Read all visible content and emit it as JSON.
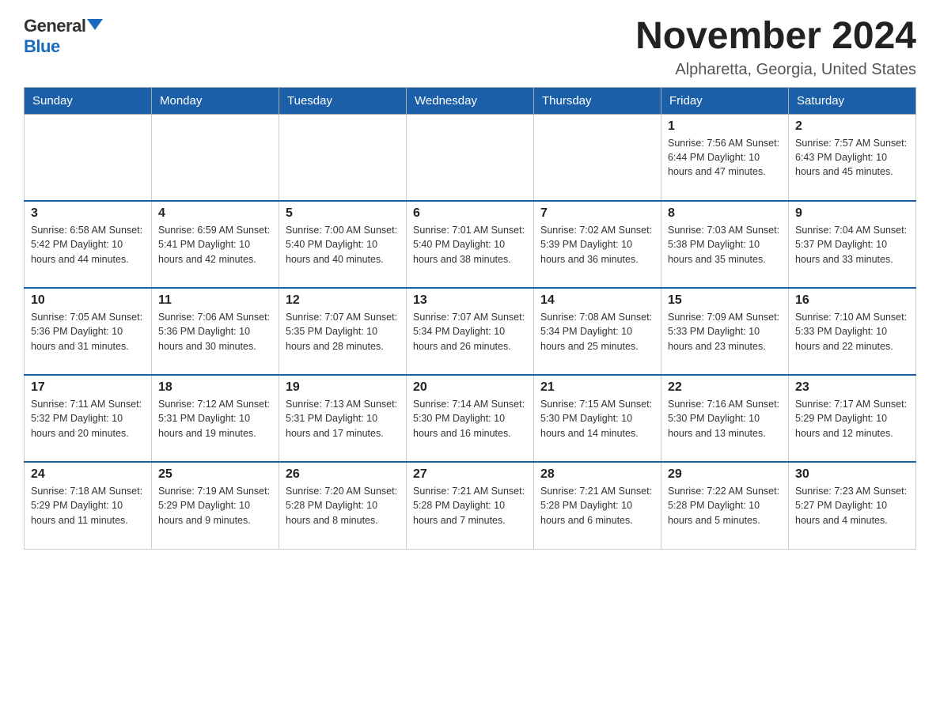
{
  "logo": {
    "general": "General",
    "blue": "Blue"
  },
  "title": "November 2024",
  "subtitle": "Alpharetta, Georgia, United States",
  "days_of_week": [
    "Sunday",
    "Monday",
    "Tuesday",
    "Wednesday",
    "Thursday",
    "Friday",
    "Saturday"
  ],
  "weeks": [
    [
      {
        "day": "",
        "info": ""
      },
      {
        "day": "",
        "info": ""
      },
      {
        "day": "",
        "info": ""
      },
      {
        "day": "",
        "info": ""
      },
      {
        "day": "",
        "info": ""
      },
      {
        "day": "1",
        "info": "Sunrise: 7:56 AM\nSunset: 6:44 PM\nDaylight: 10 hours and 47 minutes."
      },
      {
        "day": "2",
        "info": "Sunrise: 7:57 AM\nSunset: 6:43 PM\nDaylight: 10 hours and 45 minutes."
      }
    ],
    [
      {
        "day": "3",
        "info": "Sunrise: 6:58 AM\nSunset: 5:42 PM\nDaylight: 10 hours and 44 minutes."
      },
      {
        "day": "4",
        "info": "Sunrise: 6:59 AM\nSunset: 5:41 PM\nDaylight: 10 hours and 42 minutes."
      },
      {
        "day": "5",
        "info": "Sunrise: 7:00 AM\nSunset: 5:40 PM\nDaylight: 10 hours and 40 minutes."
      },
      {
        "day": "6",
        "info": "Sunrise: 7:01 AM\nSunset: 5:40 PM\nDaylight: 10 hours and 38 minutes."
      },
      {
        "day": "7",
        "info": "Sunrise: 7:02 AM\nSunset: 5:39 PM\nDaylight: 10 hours and 36 minutes."
      },
      {
        "day": "8",
        "info": "Sunrise: 7:03 AM\nSunset: 5:38 PM\nDaylight: 10 hours and 35 minutes."
      },
      {
        "day": "9",
        "info": "Sunrise: 7:04 AM\nSunset: 5:37 PM\nDaylight: 10 hours and 33 minutes."
      }
    ],
    [
      {
        "day": "10",
        "info": "Sunrise: 7:05 AM\nSunset: 5:36 PM\nDaylight: 10 hours and 31 minutes."
      },
      {
        "day": "11",
        "info": "Sunrise: 7:06 AM\nSunset: 5:36 PM\nDaylight: 10 hours and 30 minutes."
      },
      {
        "day": "12",
        "info": "Sunrise: 7:07 AM\nSunset: 5:35 PM\nDaylight: 10 hours and 28 minutes."
      },
      {
        "day": "13",
        "info": "Sunrise: 7:07 AM\nSunset: 5:34 PM\nDaylight: 10 hours and 26 minutes."
      },
      {
        "day": "14",
        "info": "Sunrise: 7:08 AM\nSunset: 5:34 PM\nDaylight: 10 hours and 25 minutes."
      },
      {
        "day": "15",
        "info": "Sunrise: 7:09 AM\nSunset: 5:33 PM\nDaylight: 10 hours and 23 minutes."
      },
      {
        "day": "16",
        "info": "Sunrise: 7:10 AM\nSunset: 5:33 PM\nDaylight: 10 hours and 22 minutes."
      }
    ],
    [
      {
        "day": "17",
        "info": "Sunrise: 7:11 AM\nSunset: 5:32 PM\nDaylight: 10 hours and 20 minutes."
      },
      {
        "day": "18",
        "info": "Sunrise: 7:12 AM\nSunset: 5:31 PM\nDaylight: 10 hours and 19 minutes."
      },
      {
        "day": "19",
        "info": "Sunrise: 7:13 AM\nSunset: 5:31 PM\nDaylight: 10 hours and 17 minutes."
      },
      {
        "day": "20",
        "info": "Sunrise: 7:14 AM\nSunset: 5:30 PM\nDaylight: 10 hours and 16 minutes."
      },
      {
        "day": "21",
        "info": "Sunrise: 7:15 AM\nSunset: 5:30 PM\nDaylight: 10 hours and 14 minutes."
      },
      {
        "day": "22",
        "info": "Sunrise: 7:16 AM\nSunset: 5:30 PM\nDaylight: 10 hours and 13 minutes."
      },
      {
        "day": "23",
        "info": "Sunrise: 7:17 AM\nSunset: 5:29 PM\nDaylight: 10 hours and 12 minutes."
      }
    ],
    [
      {
        "day": "24",
        "info": "Sunrise: 7:18 AM\nSunset: 5:29 PM\nDaylight: 10 hours and 11 minutes."
      },
      {
        "day": "25",
        "info": "Sunrise: 7:19 AM\nSunset: 5:29 PM\nDaylight: 10 hours and 9 minutes."
      },
      {
        "day": "26",
        "info": "Sunrise: 7:20 AM\nSunset: 5:28 PM\nDaylight: 10 hours and 8 minutes."
      },
      {
        "day": "27",
        "info": "Sunrise: 7:21 AM\nSunset: 5:28 PM\nDaylight: 10 hours and 7 minutes."
      },
      {
        "day": "28",
        "info": "Sunrise: 7:21 AM\nSunset: 5:28 PM\nDaylight: 10 hours and 6 minutes."
      },
      {
        "day": "29",
        "info": "Sunrise: 7:22 AM\nSunset: 5:28 PM\nDaylight: 10 hours and 5 minutes."
      },
      {
        "day": "30",
        "info": "Sunrise: 7:23 AM\nSunset: 5:27 PM\nDaylight: 10 hours and 4 minutes."
      }
    ]
  ]
}
